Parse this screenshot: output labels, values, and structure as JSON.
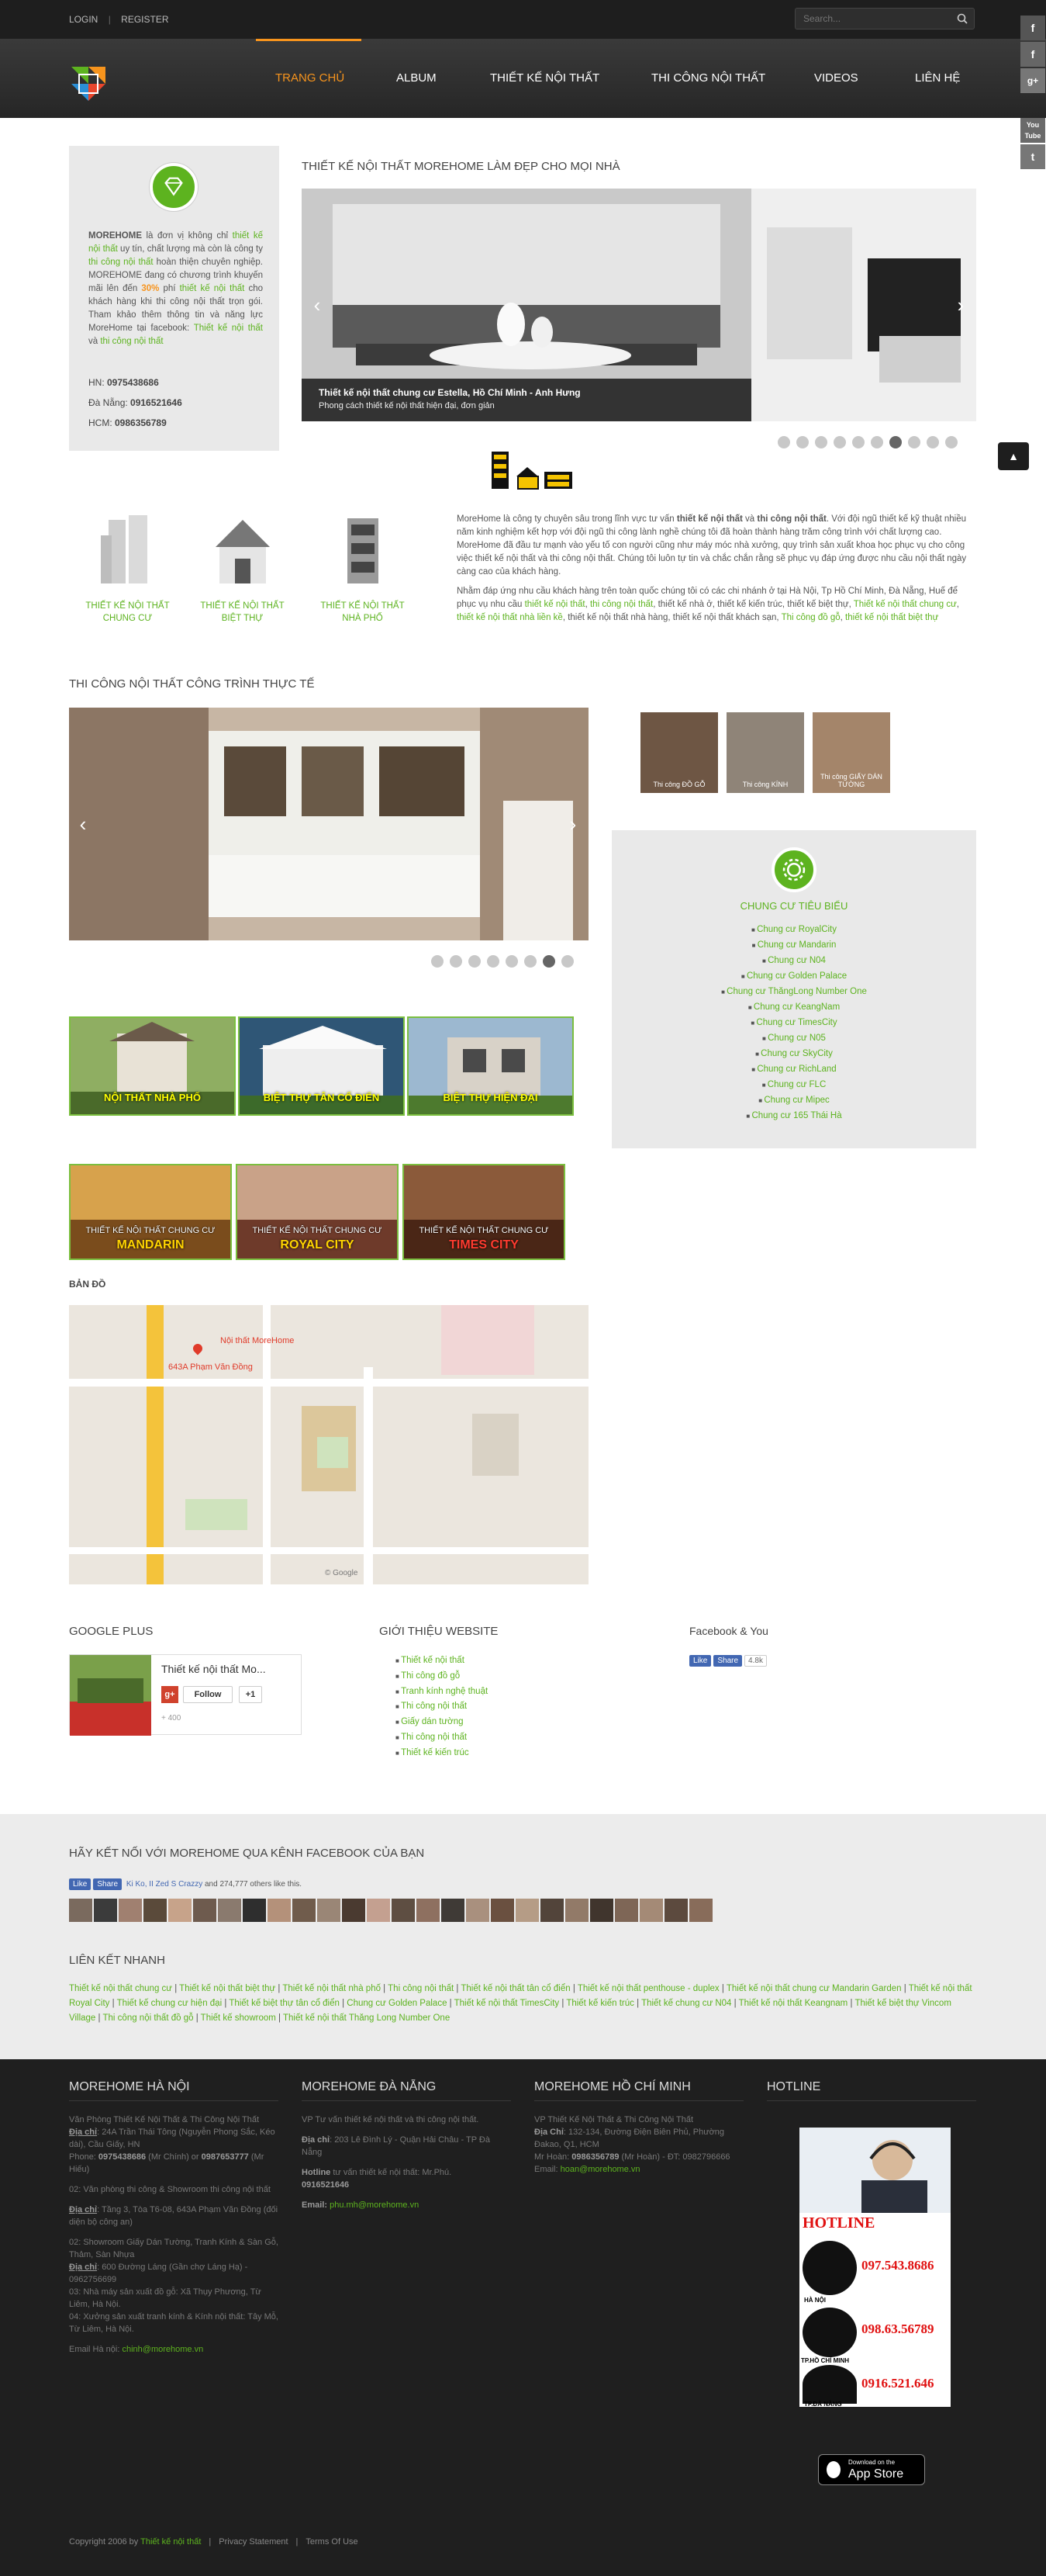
{
  "topbar": {
    "login": "LOGIN",
    "sep": "|",
    "register": "REGISTER",
    "search_placeholder": "Search..."
  },
  "nav": {
    "items": [
      "TRANG CHỦ",
      "ALBUM",
      "THIẾT KẾ NỘI THẤT",
      "THI CÔNG NỘI THẤT",
      "VIDEOS",
      "LIÊN HỆ"
    ],
    "active_color": "#f7941d"
  },
  "social": [
    "f",
    "f",
    "g+",
    "You Tube",
    "t"
  ],
  "intro": {
    "text_parts": [
      "MOREHOME",
      " là đơn vị không chỉ ",
      "thiết kế nội thất",
      " uy tín, chất lượng mà còn là công ty ",
      "thi công nội thất",
      " hoàn thiện chuyên nghiệp. MOREHOME đang có chương trình khuyến mãi lên đến ",
      "30%",
      " phí ",
      "thiết kế nội thất",
      " cho khách hàng khi thi công nội thất trọn gói. Tham khảo thêm thông tin và năng lực MoreHome tại facebook: ",
      "Thiết kế nội thất",
      " và ",
      "thi công nội thất"
    ],
    "hn": "HN: ",
    "hn_phone": "0975438686",
    "dn": "Đà Nẵng: ",
    "dn_phone": "0916521646",
    "hcm": "HCM: ",
    "hcm_phone": "0986356789"
  },
  "slider1": {
    "heading": "THIẾT KẾ NỘI THẤT MOREHOME LÀM ĐẸP CHO MỌI NHÀ",
    "caption_title": "Thiết kế nội thất chung cư Estella, Hồ Chí Minh - Anh Hưng",
    "caption_sub": "Phong cách thiết kế nội thất hiện đại, đơn giản",
    "dots": 10,
    "active_dot": 6
  },
  "categories": [
    {
      "label": "THIẾT KẾ NỘI THẤT CHUNG CƯ"
    },
    {
      "label": "THIẾT KẾ NỘI THẤT BIỆT THỰ"
    },
    {
      "label": "THIẾT KẾ NỘI THẤT NHÀ PHỐ"
    }
  ],
  "about": {
    "p1": [
      "MoreHome là công ty chuyên sâu trong lĩnh vực tư vấn ",
      "thiết kế nội thất",
      " và ",
      "thi công nội thất",
      ". Với đội ngũ thiết kế kỹ thuật nhiều năm kinh nghiệm kết hợp với đội ngũ thi công lành nghề chúng tôi đã hoàn thành hàng trăm công trình với chất lượng cao. MoreHome đã đầu tư mạnh vào yếu tố con người cũng như máy móc nhà xưởng, quy trình sản xuất khoa học phục vụ cho công việc thiết kế nội thất và thi công nội thất. Chúng tôi luôn tự tin và chắc chắn rằng sẽ phục vụ đáp ứng được nhu cầu nội thất ngày càng cao của khách hàng."
    ],
    "p2": [
      "Nhằm đáp ứng nhu cầu khách hàng trên toàn quốc chúng tôi có các chi nhánh ở tại Hà Nội, Tp Hồ Chí Minh, Đà Nẵng, Huế để phục vụ nhu cầu ",
      "thiết kế nội thất",
      ", ",
      "thi công nội thất",
      ", thiết kế nhà ở, thiết kế kiến trúc, thiết kế biệt thự, ",
      "Thiết kế nội thất chung cư",
      ", ",
      "thiết kế nội thất nhà liền kề",
      ", thiết kế nội thất nhà hàng, thiết kế nội thất khách sạn, ",
      "Thi công đồ gỗ",
      ", ",
      "thiết kế nội thất biệt thự"
    ]
  },
  "section2": {
    "heading": "THI CÔNG NỘI THẤT CÔNG TRÌNH THỰC TẾ",
    "dots": 8,
    "active_dot": 6,
    "thumbs": [
      "Thi công ĐỒ GỖ",
      "Thi công KÍNH",
      "Thi công GIẤY DÁN TƯỜNG"
    ]
  },
  "condos": {
    "title": "CHUNG CƯ TIÊU BIỂU",
    "items": [
      "Chung cư RoyalCity",
      "Chung cư Mandarin",
      "Chung cư N04",
      "Chung cư Golden Palace",
      "Chung cư ThăngLong Number One",
      "Chung cư KeangNam",
      "Chung cư TimesCity",
      "Chung cư N05",
      "Chung cư SkyCity",
      "Chung cư RichLand",
      "Chung cư FLC",
      "Chung cư Mipec",
      "Chung cư 165 Thái Hà"
    ]
  },
  "tiles_row1": [
    "NỘI THẤT NHÀ PHỐ",
    "BIỆT THỰ TÂN CỔ ĐIỂN",
    "BIỆT THỰ HIỆN ĐẠI"
  ],
  "tiles_row2": [
    {
      "top": "THIẾT KẾ NỘI THẤT CHUNG CƯ",
      "name": "MANDARIN",
      "color": "#ffd400"
    },
    {
      "top": "THIẾT KẾ NỘI THẤT CHUNG CƯ",
      "name": "ROYAL CITY",
      "color": "#ffd400"
    },
    {
      "top": "THIẾT KẾ NỘI THẤT CHUNG CƯ",
      "name": "TIMES CITY",
      "color": "#ff3b2f"
    }
  ],
  "map": {
    "heading": "BẢN ĐỒ",
    "place": "Nội thất MoreHome",
    "address": "643A Phạm Văn Đồng",
    "corner": "© Google"
  },
  "widgets": {
    "gplus_title": "GOOGLE PLUS",
    "gplus_name": "Thiết kế nội thất Mo...",
    "follow": "Follow",
    "plus1": "+1",
    "followers": "+ 400",
    "intro_title": "GIỚI THIỆU WEBSITE",
    "intro_links": [
      "Thiết kế nội thất",
      "Thi công đồ gỗ",
      "Tranh kính nghệ thuật",
      "Thi công nội thất",
      "Giấy dán tường",
      "Thi công nội thất",
      "Thiết kế kiến trúc"
    ],
    "fb_title": "Facebook & You",
    "like": "Like",
    "share": "Share",
    "fb_count": "4.8k"
  },
  "fbband": {
    "heading": "HÃY KẾT NỐI VỚI MOREHOME QUA KÊNH FACEBOOK CỦA BẠN",
    "like": "Like",
    "share": "Share",
    "names": "Ki Ko, II Zed S Crazzy",
    "others": " and 274,777 others like this."
  },
  "quicklinks": {
    "heading": "LIÊN KẾT NHANH",
    "items": [
      "Thiết kế nội thất chung cư",
      "Thiết kế nội thất biệt thự",
      "Thiết kế nội thất nhà phố",
      "Thi công nội thất",
      "Thiết kế nội thất tân cổ điển",
      "Thiết kế nội thất penthouse - duplex",
      "Thiết kế nội thất chung cư Mandarin Garden",
      "Thiết kế nội thất Royal City",
      "Thiết kế chung cư hiện đại",
      "Thiết kế biệt thự tân cổ điển",
      "Chung cư Golden Palace",
      "Thiết kế nội thất TimesCity",
      "Thiết kế kiến trúc",
      "Thiết kế chung cư N04",
      "Thiết kế nội thất Keangnam",
      "Thiết kế biệt thự Vincom Village",
      "Thi công nội thất đồ gỗ",
      "Thiết kế showroom",
      "Thiết kế nội thất Thăng Long Number One"
    ]
  },
  "footer": {
    "hn": {
      "title": "MOREHOME HÀ NỘI",
      "l1": "Văn Phòng Thiết Kế Nội Thất & Thi Công Nội Thất",
      "addr_lbl": "Địa chỉ",
      "addr": ": 24A Trần Thái Tông (Nguyễn Phong Sắc, Kéo dài), Cầu Giấy, HN",
      "phone1": "Phone: ",
      "phone1_v": "0975438686",
      "phone1_n": " (Mr Chính) or ",
      "phone2_v": "0987653777",
      "phone2_n": " (Mr Hiếu)",
      "l2": "02: Văn phòng thi công & Showroom thi công nội thất",
      "addr2_lbl": "Địa chỉ",
      "addr2": ": Tầng 3, Tòa T6-08, 643A Phạm Văn Đồng (đối diện bộ công an)",
      "l3": "02: Showroom Giấy Dán Tường, Tranh Kính & Sàn Gỗ, Thảm, Sàn Nhựa",
      "addr3_lbl": "Địa chỉ",
      "addr3": ": 600 Đường Láng (Gần chợ Láng Hạ) - 0962756699",
      "l4": "03: Nhà máy sản xuất đồ gỗ: Xã Thụy Phương, Từ Liêm, Hà Nội.",
      "l5": "04: Xưởng sản xuất tranh kính & Kính nội thất: Tây Mỗ, Từ Liêm, Hà Nội.",
      "email_lbl": "Email Hà nội: ",
      "email": "chinh@morehome.vn"
    },
    "dn": {
      "title": "MOREHOME ĐÀ NẴNG",
      "l1": "VP Tư vấn thiết kế nội thất và thi công nội thất.",
      "addr_lbl": "Địa chỉ",
      "addr": ": 203 Lê Đình Lý - Quận Hải Châu - TP Đà Nẵng",
      "hot_lbl": "Hotline",
      "hot": " tư vấn thiết kế nội thất: Mr.Phú.",
      "hot_v": "0916521646",
      "email_lbl": "Email: ",
      "email": "phu.mh@morehome.vn"
    },
    "hcm": {
      "title": "MOREHOME HỒ CHÍ MINH",
      "l1": "VP Thiết Kế Nội Thất & Thi Công Nội Thất",
      "addr_lbl": "Địa Chỉ",
      "addr": ": 132-134, Đường Điện Biên Phủ, Phường Đakao, Q1, HCM",
      "mr": "Mr Hoàn: ",
      "mr_v": "0986356789",
      "mr_n": " (Mr Hoàn) - ĐT: 0982796666",
      "email_lbl": "Email: ",
      "email": "hoan@morehome.vn"
    },
    "hotline": {
      "title": "HOTLINE",
      "word": "HOTLINE",
      "hn_num": "097.543.8686",
      "hn": "HÀ NỘI",
      "hcm_num": "098.63.56789",
      "hcm": "TP.HỒ CHÍ MINH",
      "dn_num": "0916.521.646",
      "dn": "TP.ĐÀ NẴNG"
    },
    "appstore_small": "Download on the",
    "appstore_big": "App Store"
  },
  "copyright": {
    "text": "Copyright 2006 by ",
    "link": "Thiết kế nội thất",
    "privacy": "Privacy Statement",
    "terms": "Terms Of Use",
    "sep": "|"
  }
}
